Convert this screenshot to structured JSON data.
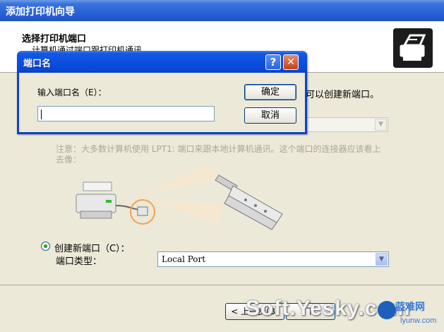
{
  "wizard": {
    "title": "添加打印机向导",
    "heading": "选择打印机端口",
    "subheading": "计算机通过端口跟打印机通讯。",
    "behind_text": "您可以创建新端口。",
    "note": "注意：大多数计算机使用 LPT1: 端口来跟本地计算机通讯。这个端口的连接器应该看上去像：",
    "create_new_port_label": "创建新端口（C）：",
    "port_type_label": "端口类型：",
    "port_type_value": "Local Port",
    "back_button": "< 上一步(B)",
    "next_button": "下"
  },
  "dialog": {
    "title": "端口名",
    "help_glyph": "?",
    "close_glyph": "✕",
    "input_label": "输入端口名（E）：",
    "input_value": "",
    "ok_button": "确定",
    "cancel_button": "取消"
  },
  "watermarks": {
    "primary": "Soft.Yesky.com",
    "secondary_title": "蓝难网",
    "secondary_url": "lyunw.com"
  },
  "colors": {
    "titlebar_blue": "#0a4fe0",
    "dialog_face": "#ece9d8",
    "radio_dot": "#21a121",
    "highlight_circle": "#f3a14a"
  }
}
